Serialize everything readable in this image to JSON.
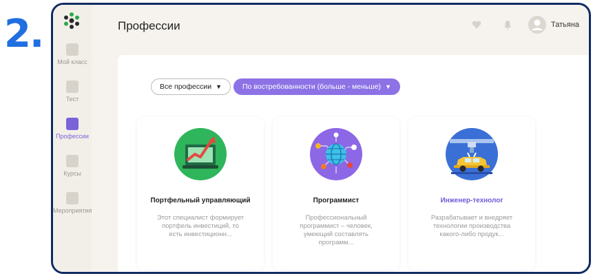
{
  "step_label": "2.",
  "header": {
    "title": "Профессии",
    "user_name": "Татьяна"
  },
  "sidebar": {
    "items": [
      {
        "label": "Мой класс",
        "icon": "school-icon",
        "active": false
      },
      {
        "label": "Тест",
        "icon": "test-icon",
        "active": false
      },
      {
        "label": "Профессии",
        "icon": "professions-icon",
        "active": true
      },
      {
        "label": "Курсы",
        "icon": "courses-icon",
        "active": false
      },
      {
        "label": "Мероприятия",
        "icon": "calendar-icon",
        "active": false
      }
    ]
  },
  "filters": {
    "all_label": "Все профессии",
    "sort_label": "По востребованности (больше - меньше)"
  },
  "cards": [
    {
      "title": "Портфельный управляющий",
      "description": "Этот специалист формирует портфель инвестиций, то есть инвестиционн...",
      "illustration": "growth-chart-icon",
      "highlighted": false
    },
    {
      "title": "Программист",
      "description": "Профессиональный программист – человек, умеющий составлять программ...",
      "illustration": "globe-network-icon",
      "highlighted": false
    },
    {
      "title": "Инженер-технолог",
      "description": "Разрабатывает и внедряет технологии производства какого-либо продук...",
      "illustration": "car-factory-icon",
      "highlighted": true
    }
  ],
  "colors": {
    "accent": "#8d72e6",
    "frame_border": "#0f2a63",
    "step_number": "#1f6fe0"
  }
}
